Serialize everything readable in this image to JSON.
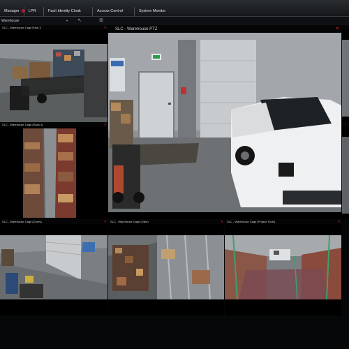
{
  "topbar": {
    "tabs": [
      {
        "label": "Manager"
      },
      {
        "label": "LPR"
      },
      {
        "label": "Facit Identity Cloak"
      },
      {
        "label": "Access Control"
      },
      {
        "label": "System Monitor"
      }
    ]
  },
  "toolbar": {
    "site_value": "Warehouse"
  },
  "cameras": {
    "rack3": {
      "title": "SLC - Warehouse Cage Rack 3"
    },
    "rack4": {
      "title": "SLC - Warehouse Cage (Rack 4)"
    },
    "ptz": {
      "title": "SLC - Warehouse PTZ"
    },
    "doors": {
      "title": "SLC - Warehouse Cage (Doors)"
    },
    "gate": {
      "title": "SLC - Warehouse Cage (Gate)"
    },
    "project": {
      "title": "SLC - Warehouse Cage (Project Tools)"
    }
  },
  "colors": {
    "alert_red": "#d11d2a",
    "tab_bar": "#2a2d31",
    "background": "#050607"
  },
  "icons": {
    "tile_close": "close-icon",
    "tool_1": "pointer-icon",
    "tool_2": "layout-icon"
  }
}
